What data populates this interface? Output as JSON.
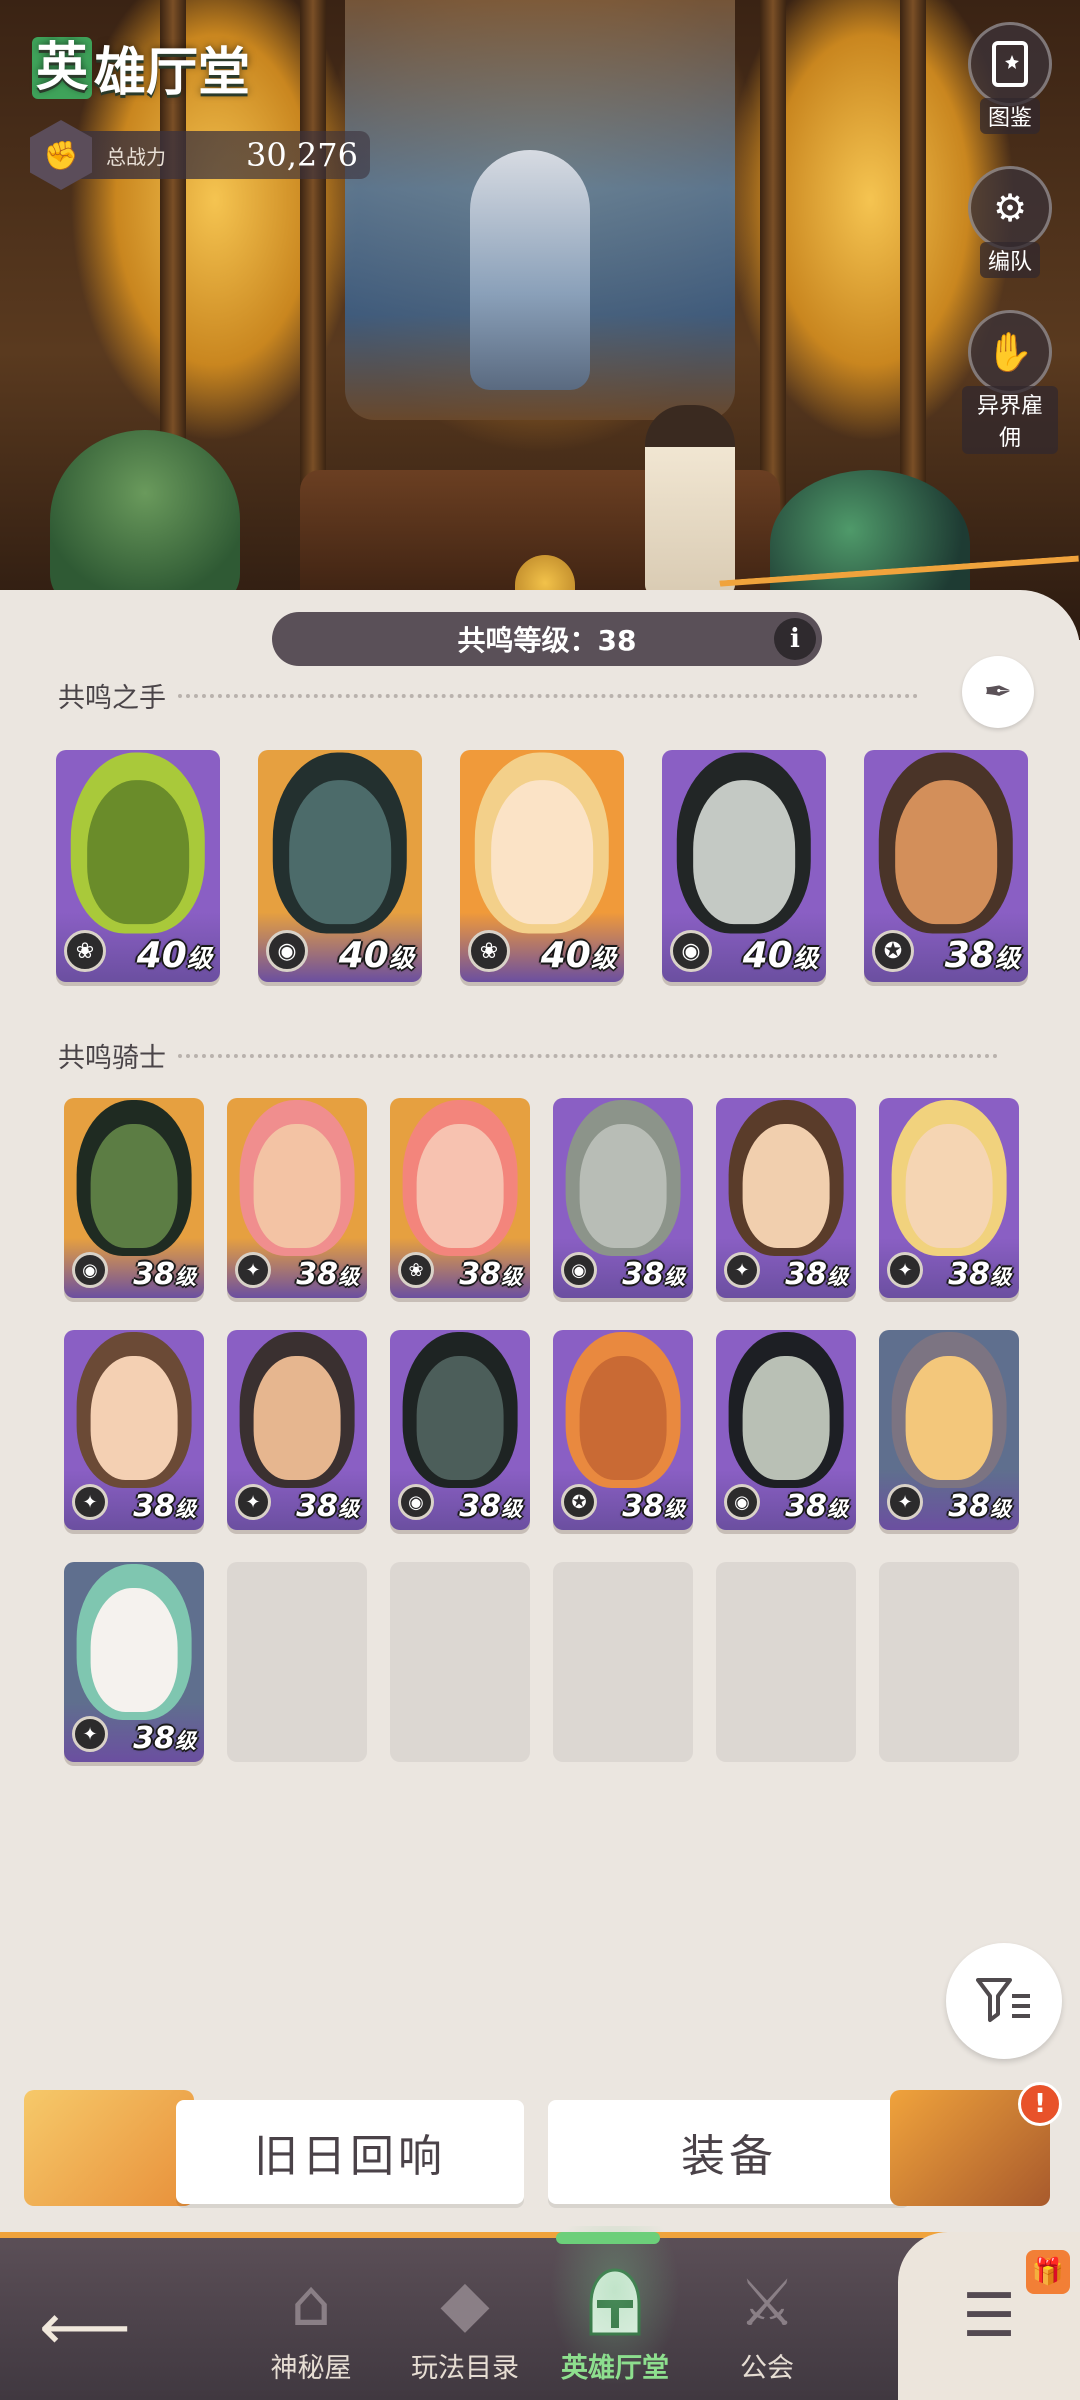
{
  "header": {
    "title_first": "英",
    "title_rest": "雄厅堂",
    "power_label": "总战力",
    "power_value": "30,276"
  },
  "side_buttons": [
    {
      "label": "图鉴",
      "icon": "book-icon"
    },
    {
      "label": "编队",
      "icon": "team-gear-icon"
    },
    {
      "label": "异界雇佣",
      "icon": "hire-icon"
    }
  ],
  "resonance": {
    "label": "共鸣等级：38",
    "info": "i"
  },
  "hands_section": {
    "title": "共鸣之手",
    "heroes": [
      {
        "level": "40",
        "unit": "级",
        "faction": "wilder",
        "bg": "#8a5fc4",
        "face": "#6a8c2a",
        "hair": "#a9c93a"
      },
      {
        "level": "40",
        "unit": "级",
        "faction": "graveborn",
        "bg": "#e6a040",
        "face": "#4c6b6a",
        "hair": "#23302f"
      },
      {
        "level": "40",
        "unit": "级",
        "faction": "wilder",
        "bg": "#f09a3a",
        "face": "#fbe3c6",
        "hair": "#f3d08a"
      },
      {
        "level": "40",
        "unit": "级",
        "faction": "graveborn",
        "bg": "#8a5fc4",
        "face": "#c4c9c4",
        "hair": "#222626"
      },
      {
        "level": "38",
        "unit": "级",
        "faction": "mauler",
        "bg": "#8a5fc4",
        "face": "#d38f5a",
        "hair": "#4a3428"
      }
    ]
  },
  "knights_section": {
    "title": "共鸣骑士",
    "heroes": [
      {
        "level": "38",
        "unit": "级",
        "faction": "graveborn",
        "bg": "#e6a040",
        "face": "#5c7d44",
        "hair": "#1f2b22"
      },
      {
        "level": "38",
        "unit": "级",
        "faction": "lightbearer",
        "bg": "#e6a040",
        "face": "#f3c3a4",
        "hair": "#f08e8e"
      },
      {
        "level": "38",
        "unit": "级",
        "faction": "wilder",
        "bg": "#e6a040",
        "face": "#f7c2b0",
        "hair": "#f3857c"
      },
      {
        "level": "38",
        "unit": "级",
        "faction": "graveborn",
        "bg": "#8a5fc4",
        "face": "#b8bdb6",
        "hair": "#8c948a"
      },
      {
        "level": "38",
        "unit": "级",
        "faction": "lightbearer",
        "bg": "#8a5fc4",
        "face": "#f1cfae",
        "hair": "#5a3c2a"
      },
      {
        "level": "38",
        "unit": "级",
        "faction": "lightbearer",
        "bg": "#8a5fc4",
        "face": "#f5d5b3",
        "hair": "#f1d27d"
      },
      {
        "level": "38",
        "unit": "级",
        "faction": "lightbearer",
        "bg": "#8a5fc4",
        "face": "#f4d0b3",
        "hair": "#6b4a36"
      },
      {
        "level": "38",
        "unit": "级",
        "faction": "lightbearer",
        "bg": "#8a5fc4",
        "face": "#e6b68f",
        "hair": "#3a3030"
      },
      {
        "level": "38",
        "unit": "级",
        "faction": "graveborn",
        "bg": "#8a5fc4",
        "face": "#4c5e5a",
        "hair": "#1e2423"
      },
      {
        "level": "38",
        "unit": "级",
        "faction": "mauler",
        "bg": "#8a5fc4",
        "face": "#c96a34",
        "hair": "#e9893f"
      },
      {
        "level": "38",
        "unit": "级",
        "faction": "graveborn",
        "bg": "#8a5fc4",
        "face": "#b9c0b5",
        "hair": "#1d1f24"
      },
      {
        "level": "38",
        "unit": "级",
        "faction": "lightbearer",
        "bg": "#5f6f8e",
        "face": "#f3c77b",
        "hair": "#7c7482"
      },
      {
        "level": "38",
        "unit": "级",
        "faction": "lightbearer",
        "bg": "#5f6f8e",
        "face": "#f5f2ee",
        "hair": "#7fc6b0"
      }
    ],
    "empty_slots": 5
  },
  "filter_icon": "filter-list-icon",
  "actions": {
    "echo_label": "旧日回响",
    "equip_label": "装备",
    "alert": "!"
  },
  "nav": {
    "back_icon": "back-arrow-icon",
    "items": [
      {
        "label": "神秘屋",
        "icon": "mystery-house-icon"
      },
      {
        "label": "玩法目录",
        "icon": "modes-icon"
      },
      {
        "label": "英雄厅堂",
        "icon": "knight-helmet-icon"
      },
      {
        "label": "公会",
        "icon": "crossed-swords-icon"
      }
    ],
    "menu_icon": "menu-icon"
  },
  "colors": {
    "accent_orange": "#f0a33c",
    "nav_bg": "#4c424a",
    "active_green": "#6ccf7a",
    "page_bg": "#ebe6e0"
  }
}
